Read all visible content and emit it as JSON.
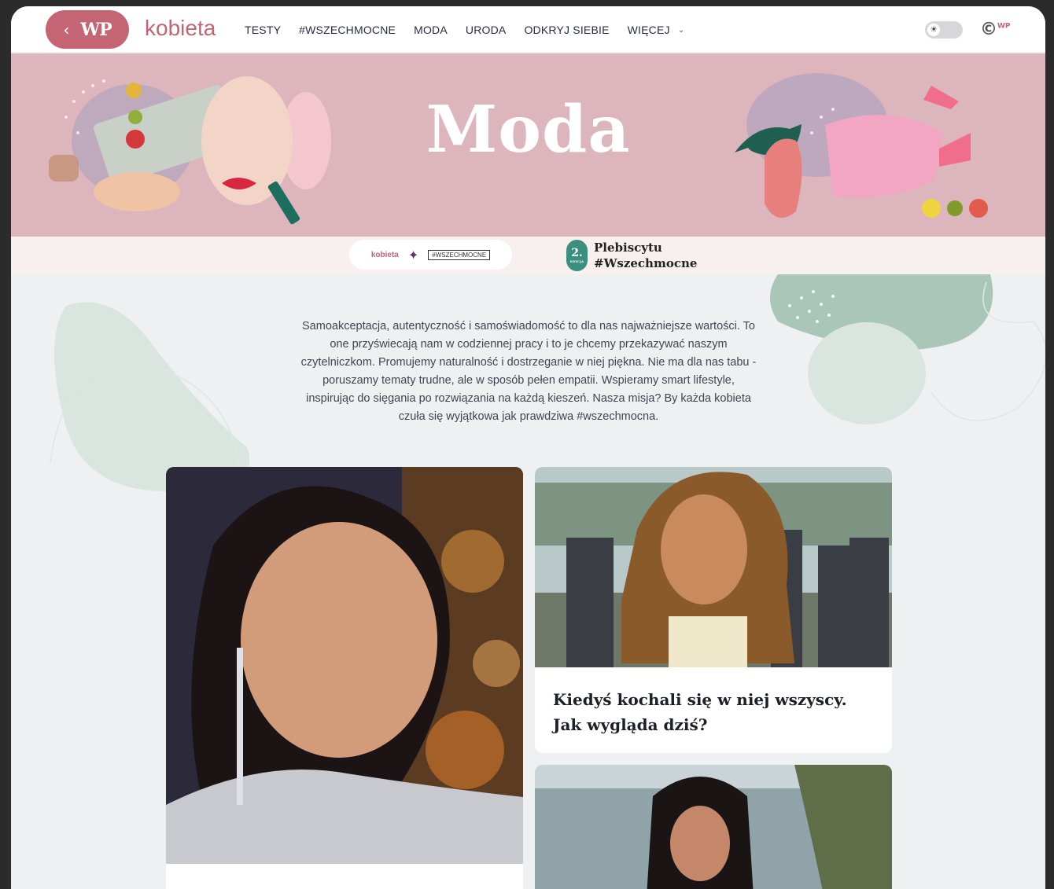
{
  "header": {
    "back_icon": "chevron-left-icon",
    "wp_logo_text": "WP",
    "brand": "kobieta",
    "menu": [
      "TESTY",
      "#WSZECHMOCNE",
      "MODA",
      "URODA",
      "ODKRYJ SIEBIE"
    ],
    "more_label": "WIĘCEJ",
    "theme_icon": "sun-icon",
    "wp_corner_logo": "WP"
  },
  "banner": {
    "title": "Moda",
    "background": "#ddb5bd"
  },
  "subbar": {
    "logo_kobieta": "kobieta",
    "logo_wszechmocne": "#WSZECHMOCNE",
    "badge_number": "2.",
    "badge_caption": "EDYCJA",
    "plebiscyt_line1": "Plebiscytu",
    "plebiscyt_line2": "#Wszechmocne"
  },
  "intro": {
    "text": "Samoakceptacja, autentyczność i samoświadomość to dla nas najważniejsze wartości. To one przyświecają nam w codziennej pracy i to je chcemy przekazywać naszym czytelniczkom. Promujemy naturalność i dostrzeganie w niej piękna. Nie ma dla nas tabu - poruszamy tematy trudne, ale w sposób pełen empatii. Wspieramy smart lifestyle, inspirując do sięgania po rozwiązania na każdą kieszeń. Nasza misja? By każda kobieta czuła się wyjątkowa jak prawdziwa #wszechmocna."
  },
  "articles": [
    {
      "title": ""
    },
    {
      "title": "Kiedyś kochali się w niej wszyscy. Jak wygląda dziś?"
    },
    {
      "title": ""
    }
  ],
  "colors": {
    "accent": "#c56472",
    "page_bg": "#eef0f2",
    "green_blob": "#a9c6b8"
  }
}
